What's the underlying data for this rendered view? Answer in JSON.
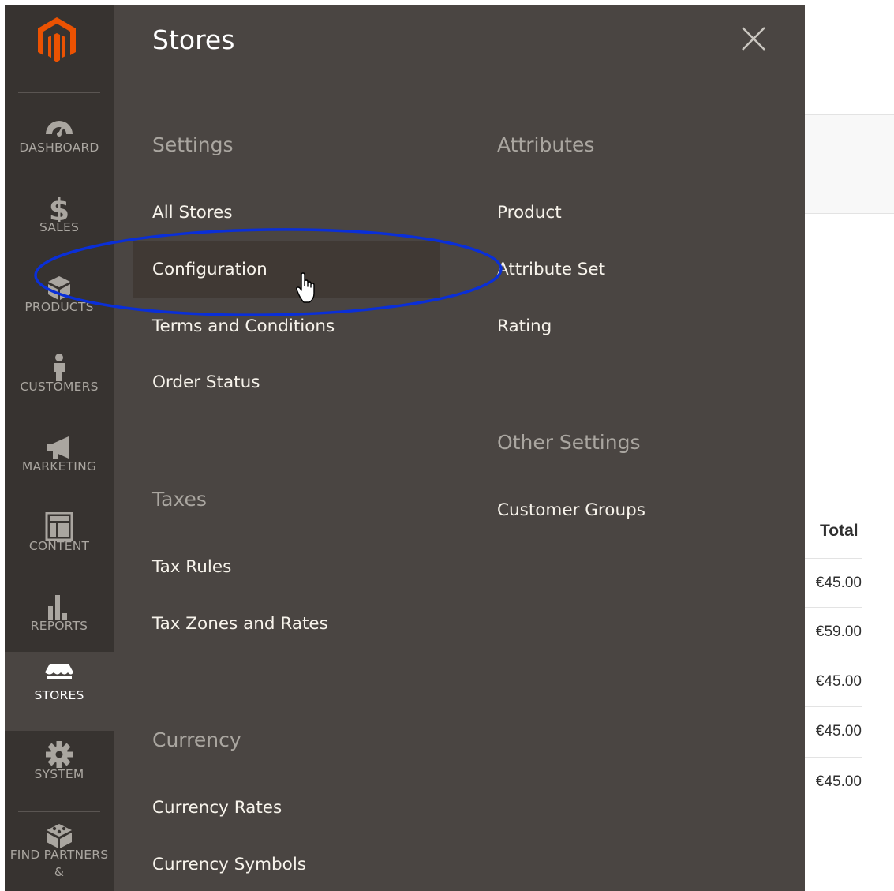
{
  "sidebar": {
    "logo_icon": "magento-logo",
    "accent_color": "#eb5202",
    "items": [
      {
        "label": "Dashboard",
        "icon": "dashboard-gauge-icon"
      },
      {
        "label": "Sales",
        "icon": "dollar-icon"
      },
      {
        "label": "Products",
        "icon": "box-icon"
      },
      {
        "label": "Customers",
        "icon": "person-icon"
      },
      {
        "label": "Marketing",
        "icon": "megaphone-icon"
      },
      {
        "label": "Content",
        "icon": "layout-icon"
      },
      {
        "label": "Reports",
        "icon": "bar-chart-icon"
      },
      {
        "label": "Stores",
        "icon": "storefront-icon",
        "active": true
      },
      {
        "label": "System",
        "icon": "gear-icon"
      },
      {
        "label": "Find Partners &",
        "icon": "blocks-icon"
      }
    ]
  },
  "flyout": {
    "title": "Stores",
    "close_icon": "close-icon",
    "settings": {
      "title": "Settings",
      "links": [
        "All Stores",
        "Configuration",
        "Terms and Conditions",
        "Order Status"
      ]
    },
    "taxes": {
      "title": "Taxes",
      "links": [
        "Tax Rules",
        "Tax Zones and Rates"
      ]
    },
    "currency": {
      "title": "Currency",
      "links": [
        "Currency Rates",
        "Currency Symbols"
      ]
    },
    "attributes": {
      "title": "Attributes",
      "links": [
        "Product",
        "Attribute Set",
        "Rating"
      ]
    },
    "other_settings": {
      "title": "Other Settings",
      "links": [
        "Customer Groups"
      ]
    },
    "hovered_link": "Configuration",
    "annotation_color": "#0a2fd8"
  },
  "background_table": {
    "header": "Total",
    "totals": [
      "€45.00",
      "€59.00",
      "€45.00",
      "€45.00",
      "€45.00"
    ]
  }
}
